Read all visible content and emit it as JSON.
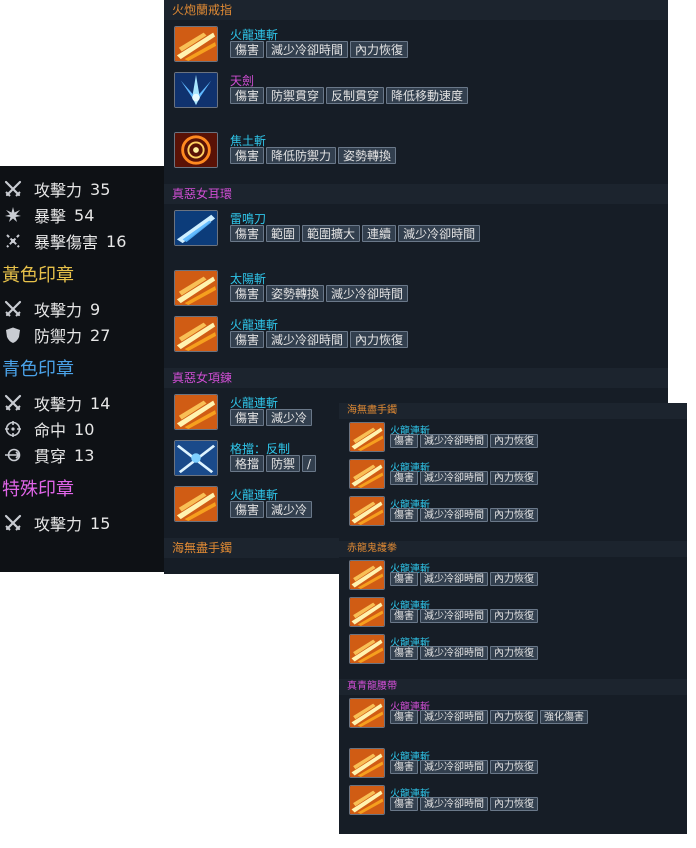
{
  "colors": {
    "cyan": "#2fc6ea",
    "magenta": "#d04ed4",
    "orange": "#e08a34",
    "yellow": "#e7c14a",
    "blue": "#4aa2e8",
    "pink": "#e065e8"
  },
  "stats_panel": {
    "stats_a": [
      {
        "icon": "crossed-swords-icon",
        "name": "攻擊力",
        "value": "35"
      },
      {
        "icon": "burst-icon",
        "name": "暴擊",
        "value": "54"
      },
      {
        "icon": "crit-damage-icon",
        "name": "暴擊傷害",
        "value": "16"
      }
    ],
    "yellow_seal": {
      "title": "黃色印章",
      "stats": [
        {
          "icon": "crossed-swords-icon",
          "name": "攻擊力",
          "value": "9"
        },
        {
          "icon": "shield-icon",
          "name": "防禦力",
          "value": "27"
        }
      ]
    },
    "blue_seal": {
      "title": "青色印章",
      "stats": [
        {
          "icon": "crossed-swords-icon",
          "name": "攻擊力",
          "value": "14"
        },
        {
          "icon": "crosshair-icon",
          "name": "命中",
          "value": "10"
        },
        {
          "icon": "pierce-icon",
          "name": "貫穿",
          "value": "13"
        }
      ]
    },
    "special_seal": {
      "title": "特殊印章",
      "stats": [
        {
          "icon": "crossed-swords-icon",
          "name": "攻擊力",
          "value": "15"
        }
      ]
    }
  },
  "panel_a": {
    "sections": [
      {
        "title": "火炮蘭戒指",
        "skills": [
          {
            "name": "火龍連斬",
            "icon": "fire-slash-icon",
            "tags": [
              "傷害",
              "減少冷卻時間",
              "內力恢復"
            ]
          },
          {
            "name": "天劍",
            "icon": "sky-sword-icon",
            "tags": [
              "傷害",
              "防禦貫穿",
              "反制貫穿",
              "降低移動速度"
            ]
          },
          {
            "name": "焦土斬",
            "icon": "scorched-earth-icon",
            "tags": [
              "傷害",
              "降低防禦力",
              "姿勢轉換"
            ]
          }
        ]
      },
      {
        "title": "真惡女耳環",
        "skills": [
          {
            "name": "雷鳴刀",
            "icon": "thunder-blade-icon",
            "tags": [
              "傷害",
              "範圍",
              "範圍擴大",
              "連續",
              "減少冷卻時間"
            ]
          },
          {
            "name": "太陽斬",
            "icon": "sun-slash-icon",
            "tags": [
              "傷害",
              "姿勢轉換",
              "減少冷卻時間"
            ]
          },
          {
            "name": "火龍連斬",
            "icon": "fire-slash-icon",
            "tags": [
              "傷害",
              "減少冷卻時間",
              "內力恢復"
            ]
          }
        ]
      },
      {
        "title": "真惡女項鍊",
        "skills": [
          {
            "name": "火龍連斬",
            "icon": "fire-slash-icon",
            "tags": [
              "傷害",
              "減少冷"
            ]
          },
          {
            "name": "格擋：反制",
            "icon": "block-counter-icon",
            "tags": [
              "格擋",
              "防禦",
              "/"
            ]
          },
          {
            "name": "火龍連斬",
            "icon": "fire-slash-icon",
            "tags": [
              "傷害",
              "減少冷"
            ]
          }
        ]
      },
      {
        "title": "海無盡手鐲",
        "skills": []
      }
    ]
  },
  "panel_b": {
    "sections": [
      {
        "title": "海無盡手鐲",
        "skills": [
          {
            "name": "火龍連斬",
            "icon": "fire-slash-icon",
            "tags": [
              "傷害",
              "減少冷卻時間",
              "內力恢復"
            ]
          },
          {
            "name": "火龍連斬",
            "icon": "fire-slash-icon",
            "tags": [
              "傷害",
              "減少冷卻時間",
              "內力恢復"
            ]
          },
          {
            "name": "火龍連斬",
            "icon": "fire-slash-icon",
            "tags": [
              "傷害",
              "減少冷卻時間",
              "內力恢復"
            ]
          }
        ]
      },
      {
        "title": "赤龍鬼護拳",
        "skills": [
          {
            "name": "火龍連斬",
            "icon": "fire-slash-icon",
            "tags": [
              "傷害",
              "減少冷卻時間",
              "內力恢復"
            ]
          },
          {
            "name": "火龍連斬",
            "icon": "fire-slash-icon",
            "tags": [
              "傷害",
              "減少冷卻時間",
              "內力恢復"
            ]
          },
          {
            "name": "火龍連斬",
            "icon": "fire-slash-icon",
            "tags": [
              "傷害",
              "減少冷卻時間",
              "內力恢復"
            ]
          }
        ]
      },
      {
        "title": "真青龍腰帶",
        "skills": [
          {
            "name": "火龍連斬",
            "icon": "fire-slash-icon",
            "tags": [
              "傷害",
              "減少冷卻時間",
              "內力恢復",
              "強化傷害"
            ]
          },
          {
            "name": "火龍連斬",
            "icon": "fire-slash-icon",
            "tags": [
              "傷害",
              "減少冷卻時間",
              "內力恢復"
            ]
          },
          {
            "name": "火龍連斬",
            "icon": "fire-slash-icon",
            "tags": [
              "傷害",
              "減少冷卻時間",
              "內力恢復"
            ]
          }
        ]
      }
    ]
  }
}
